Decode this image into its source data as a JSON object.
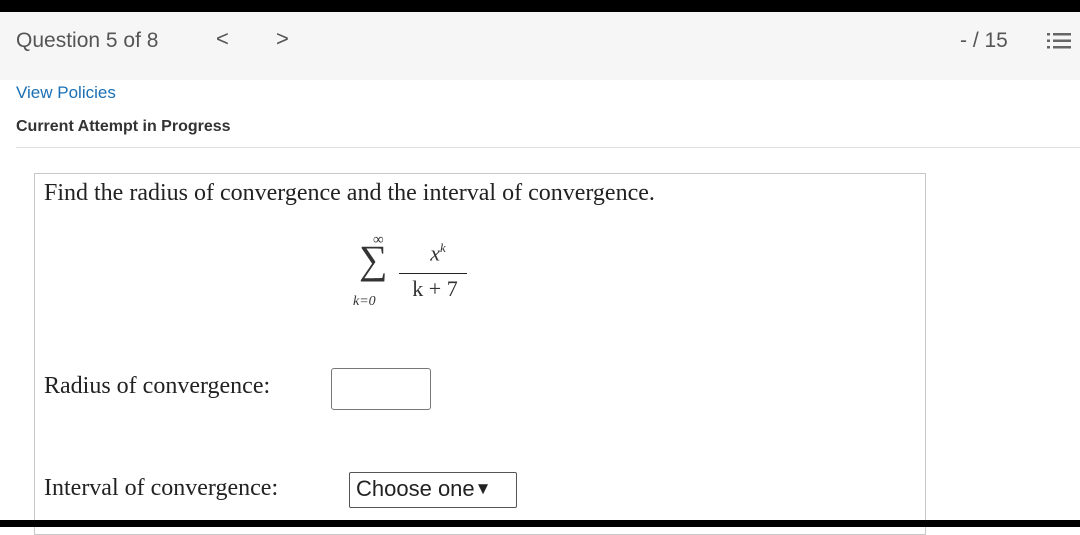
{
  "header": {
    "question_counter": "Question 5 of 8",
    "prev_glyph": "<",
    "next_glyph": ">",
    "score": "- / 15",
    "menu_icon": "list-icon"
  },
  "links": {
    "view_policies": "View Policies"
  },
  "status": {
    "attempt": "Current Attempt in Progress"
  },
  "question": {
    "prompt": "Find the radius of convergence and the interval of convergence.",
    "series": {
      "upper_limit": "∞",
      "sigma": "∑",
      "lower_limit": "k=0",
      "numerator_base": "x",
      "numerator_exp": "k",
      "denominator": "k + 7"
    },
    "radius_label": "Radius of convergence:",
    "radius_value": "",
    "interval_label": "Interval of convergence:",
    "interval_selected": "Choose one",
    "interval_arrow": "▼"
  }
}
